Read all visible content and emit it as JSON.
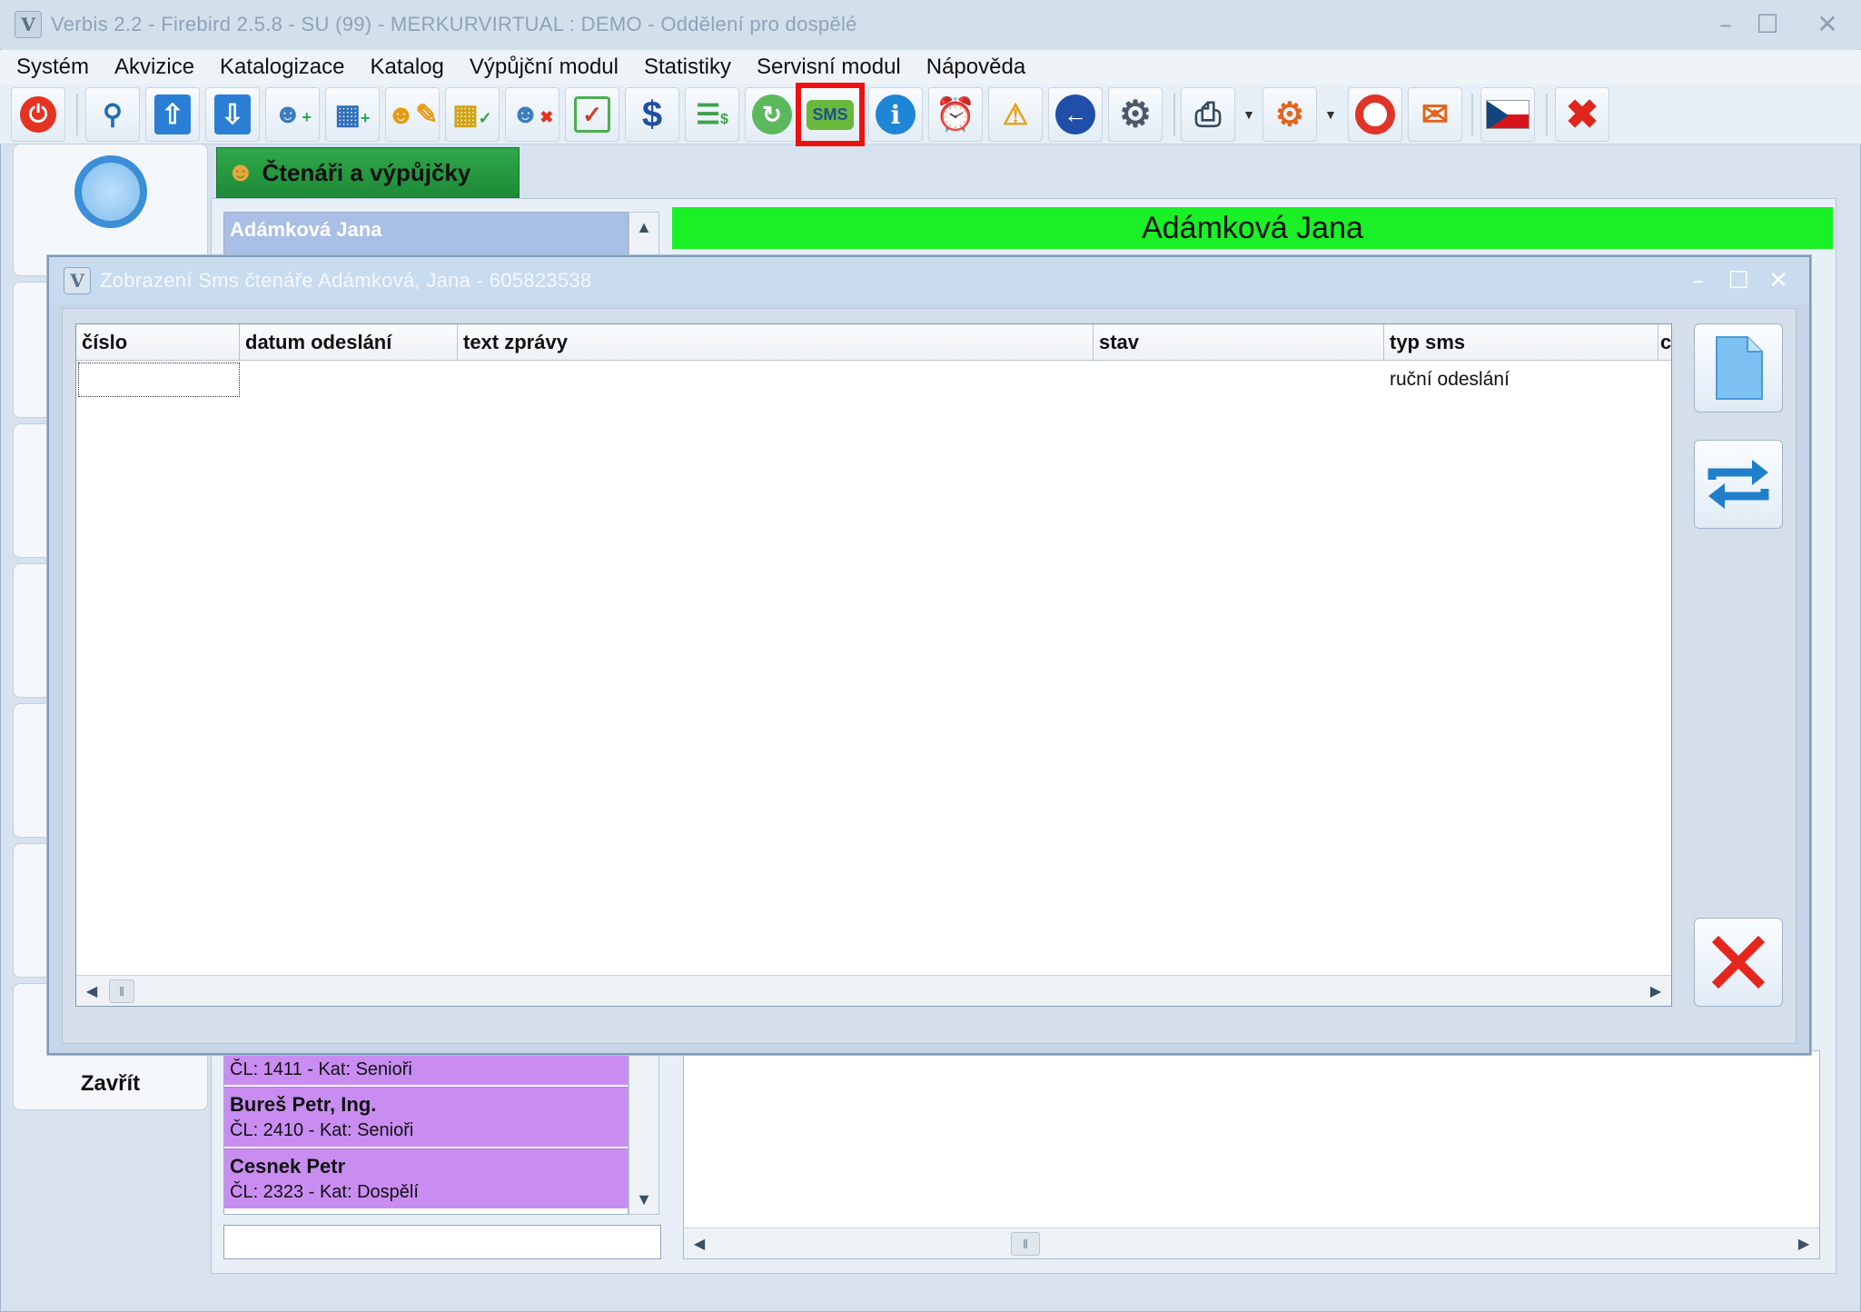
{
  "window": {
    "title": "Verbis 2.2 - Firebird 2.5.8 - SU (99) - MERKURVIRTUAL : DEMO - Oddělení pro dospělé"
  },
  "menu": [
    "Systém",
    "Akvizice",
    "Katalogizace",
    "Katalog",
    "Výpůjční modul",
    "Statistiky",
    "Servisní modul",
    "Nápověda"
  ],
  "toolbar": {
    "sms_label": "SMS",
    "highlight_color": "#ee1111",
    "icons": [
      "power-icon",
      "search-icon",
      "upload-icon",
      "download-icon",
      "add-reader-icon",
      "add-items-icon",
      "edit-reader-icon",
      "checked-items-icon",
      "remove-reader-icon",
      "checkbox-icon",
      "dollar-icon",
      "payments-list-icon",
      "refresh-icon",
      "sms-icon",
      "info-icon",
      "alarm-clock-icon",
      "reminder-warning-icon",
      "back-arrow-icon",
      "settings-gear-icon",
      "printer-icon",
      "configuration-gears-icon",
      "help-lifebuoy-icon",
      "messages-icon",
      "czech-flag-icon",
      "close-x-icon"
    ]
  },
  "left_panel": {
    "close_label": "Zavřít"
  },
  "tab": {
    "label": "Čtenáři a výpůjčky"
  },
  "reader_list": {
    "selected": {
      "name": "Adámková Jana"
    },
    "items": [
      {
        "name": "Bureš Petr, Ing.",
        "sub": "ČL: 2410 - Kat: Senioři"
      },
      {
        "name": "Cesnek Petr",
        "sub": "ČL: 2323 - Kat: Dospělí"
      }
    ],
    "partial_sub": "ČL: 1411 - Kat: Senioři"
  },
  "banner": {
    "name": "Adámková Jana",
    "color": "#19f026"
  },
  "dialog": {
    "title": "Zobrazení  Sms čtenáře Adámková, Jana - 605823538",
    "columns": [
      "číslo",
      "datum odeslání",
      "text zprávy",
      "stav",
      "typ sms",
      "c"
    ],
    "rows": [
      {
        "cislo": "",
        "datum": "",
        "text": "",
        "stav": "",
        "typ": "ruční odeslání"
      }
    ],
    "buttons": [
      "new-document-icon",
      "refresh-arrows-icon",
      "close-x-icon"
    ]
  }
}
